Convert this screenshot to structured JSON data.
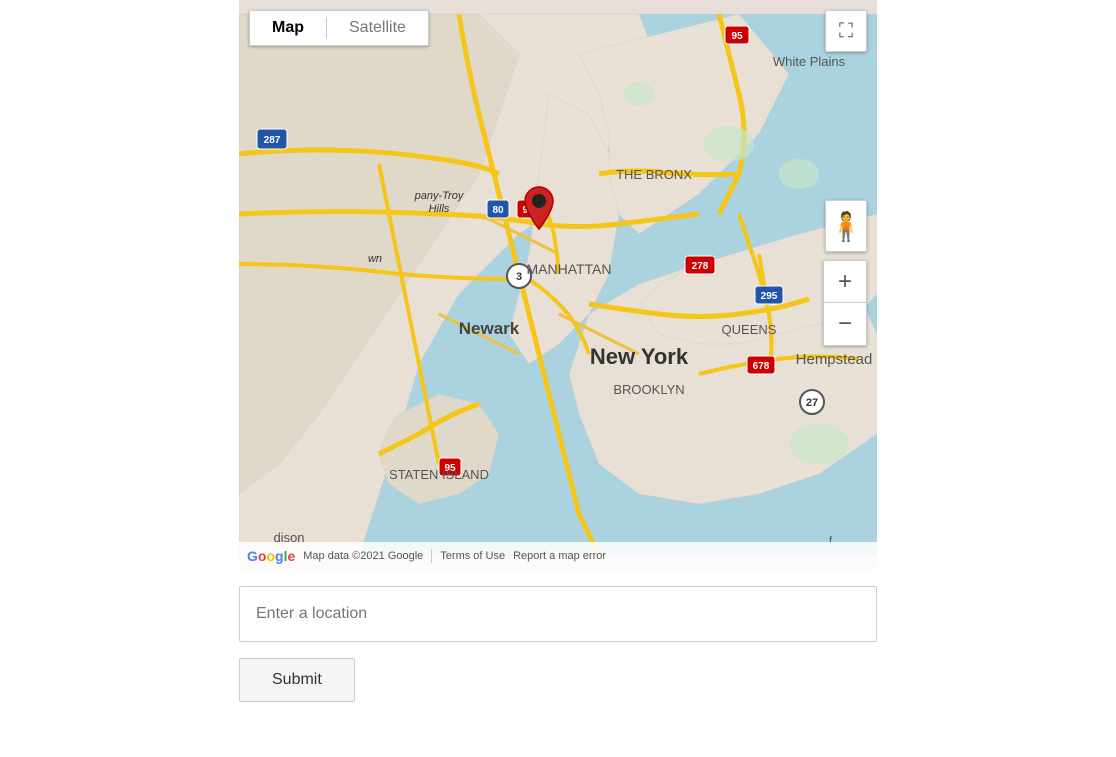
{
  "map": {
    "type_buttons": [
      {
        "label": "Map",
        "active": true
      },
      {
        "label": "Satellite",
        "active": false
      }
    ],
    "fullscreen_label": "⛶",
    "zoom_in_label": "+",
    "zoom_out_label": "−",
    "footer": {
      "copyright": "Map data ©2021 Google",
      "terms": "Terms of Use",
      "report": "Report a map error"
    },
    "location": {
      "city": "New York",
      "area": "MANHATTAN",
      "bronx": "THE BRONX",
      "brooklyn": "BROOKLYN",
      "queens": "QUEENS",
      "newark": "Newark",
      "white_plains": "White Plains",
      "hempstead": "Hempstead",
      "staten_island": "STATEN ISLAND"
    },
    "routes": {
      "labels": [
        "287",
        "95",
        "80",
        "35",
        "3",
        "278",
        "295",
        "678",
        "27",
        "95"
      ]
    }
  },
  "input": {
    "placeholder": "Enter a location"
  },
  "submit": {
    "label": "Submit"
  }
}
